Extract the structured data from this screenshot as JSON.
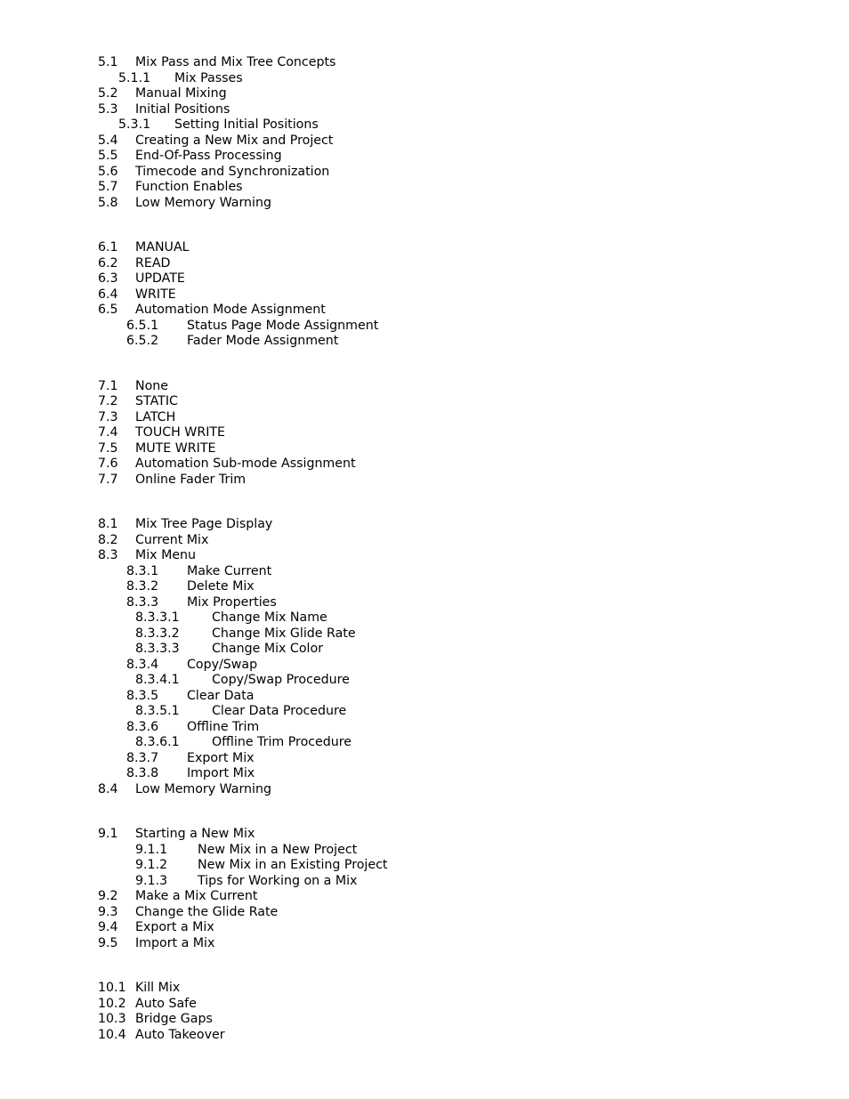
{
  "document": {
    "type": "table-of-contents",
    "text_color": "#000000",
    "background_color": "#ffffff"
  },
  "toc": {
    "blocks": [
      {
        "section": "5",
        "entries": [
          {
            "number": "5.1",
            "title": "Mix Pass and Mix Tree Concepts",
            "level": "lvl1"
          },
          {
            "number": "5.1.1",
            "title": "Mix Passes",
            "level": "lvl2a"
          },
          {
            "number": "5.2",
            "title": "Manual Mixing",
            "level": "lvl1"
          },
          {
            "number": "5.3",
            "title": "Initial Positions",
            "level": "lvl1"
          },
          {
            "number": "5.3.1",
            "title": "Setting Initial Positions",
            "level": "lvl2a"
          },
          {
            "number": "5.4",
            "title": "Creating a New Mix and Project",
            "level": "lvl1"
          },
          {
            "number": "5.5",
            "title": "End-Of-Pass Processing",
            "level": "lvl1"
          },
          {
            "number": "5.6",
            "title": "Timecode and Synchronization",
            "level": "lvl1"
          },
          {
            "number": "5.7",
            "title": "Function Enables",
            "level": "lvl1"
          },
          {
            "number": "5.8",
            "title": "Low Memory Warning",
            "level": "lvl1"
          }
        ]
      },
      {
        "section": "6",
        "entries": [
          {
            "number": "6.1",
            "title": "MANUAL",
            "level": "lvl1"
          },
          {
            "number": "6.2",
            "title": "READ",
            "level": "lvl1"
          },
          {
            "number": "6.3",
            "title": "UPDATE",
            "level": "lvl1"
          },
          {
            "number": "6.4",
            "title": "WRITE",
            "level": "lvl1"
          },
          {
            "number": "6.5",
            "title": "Automation Mode Assignment",
            "level": "lvl1"
          },
          {
            "number": "6.5.1",
            "title": "Status Page Mode Assignment",
            "level": "lvl2b"
          },
          {
            "number": "6.5.2",
            "title": "Fader Mode Assignment",
            "level": "lvl2b"
          }
        ]
      },
      {
        "section": "7",
        "entries": [
          {
            "number": "7.1",
            "title": "None",
            "level": "lvl1"
          },
          {
            "number": "7.2",
            "title": "STATIC",
            "level": "lvl1"
          },
          {
            "number": "7.3",
            "title": "LATCH",
            "level": "lvl1"
          },
          {
            "number": "7.4",
            "title": "TOUCH WRITE",
            "level": "lvl1"
          },
          {
            "number": "7.5",
            "title": "MUTE WRITE",
            "level": "lvl1"
          },
          {
            "number": "7.6",
            "title": "Automation Sub-mode Assignment",
            "level": "lvl1"
          },
          {
            "number": "7.7",
            "title": "Online Fader Trim",
            "level": "lvl1"
          }
        ]
      },
      {
        "section": "8",
        "entries": [
          {
            "number": "8.1",
            "title": "Mix Tree Page Display",
            "level": "lvl1"
          },
          {
            "number": "8.2",
            "title": "Current Mix",
            "level": "lvl1"
          },
          {
            "number": "8.3",
            "title": "Mix Menu",
            "level": "lvl1"
          },
          {
            "number": "8.3.1",
            "title": "Make Current",
            "level": "lvl2b"
          },
          {
            "number": "8.3.2",
            "title": "Delete Mix",
            "level": "lvl2b"
          },
          {
            "number": "8.3.3",
            "title": "Mix Properties",
            "level": "lvl2b"
          },
          {
            "number": "8.3.3.1",
            "title": "Change Mix Name",
            "level": "lvl3"
          },
          {
            "number": "8.3.3.2",
            "title": "Change Mix Glide Rate",
            "level": "lvl3"
          },
          {
            "number": "8.3.3.3",
            "title": "Change Mix Color",
            "level": "lvl3"
          },
          {
            "number": "8.3.4",
            "title": "Copy/Swap",
            "level": "lvl2b"
          },
          {
            "number": "8.3.4.1",
            "title": "Copy/Swap Procedure",
            "level": "lvl3"
          },
          {
            "number": "8.3.5",
            "title": "Clear Data",
            "level": "lvl2b"
          },
          {
            "number": "8.3.5.1",
            "title": "Clear Data Procedure",
            "level": "lvl3"
          },
          {
            "number": "8.3.6",
            "title": "Offline Trim",
            "level": "lvl2b"
          },
          {
            "number": "8.3.6.1",
            "title": "Offline Trim Procedure",
            "level": "lvl3"
          },
          {
            "number": "8.3.7",
            "title": "Export Mix",
            "level": "lvl2b"
          },
          {
            "number": "8.3.8",
            "title": "Import Mix",
            "level": "lvl2b"
          },
          {
            "number": "8.4",
            "title": "Low Memory Warning",
            "level": "lvl1"
          }
        ]
      },
      {
        "section": "9",
        "entries": [
          {
            "number": "9.1",
            "title": "Starting a New Mix",
            "level": "lvl1"
          },
          {
            "number": "9.1.1",
            "title": "New Mix in a New Project",
            "level": "lvl2c"
          },
          {
            "number": "9.1.2",
            "title": "New Mix in an Existing Project",
            "level": "lvl2c"
          },
          {
            "number": "9.1.3",
            "title": "Tips for Working on a Mix",
            "level": "lvl2c"
          },
          {
            "number": "9.2",
            "title": "Make a Mix Current",
            "level": "lvl1"
          },
          {
            "number": "9.3",
            "title": "Change the Glide Rate",
            "level": "lvl1"
          },
          {
            "number": "9.4",
            "title": "Export a Mix",
            "level": "lvl1"
          },
          {
            "number": "9.5",
            "title": "Import a Mix",
            "level": "lvl1"
          }
        ]
      },
      {
        "section": "10",
        "entries": [
          {
            "number": "10.1",
            "title": "Kill Mix",
            "level": "lvl1w"
          },
          {
            "number": "10.2",
            "title": "Auto Safe",
            "level": "lvl1w"
          },
          {
            "number": "10.3",
            "title": "Bridge Gaps",
            "level": "lvl1w"
          },
          {
            "number": "10.4",
            "title": "Auto Takeover",
            "level": "lvl1w"
          }
        ]
      }
    ]
  }
}
